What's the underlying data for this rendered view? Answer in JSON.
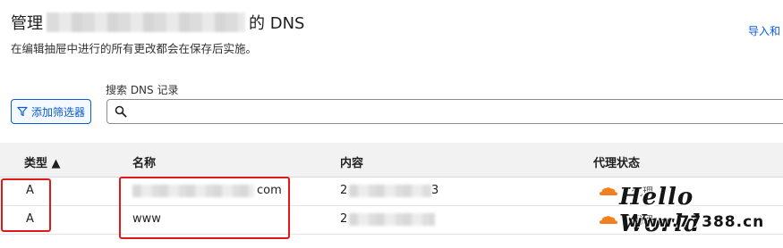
{
  "header": {
    "title_prefix": "管理",
    "title_suffix": "的 DNS",
    "subtitle": "在编辑抽屉中进行的所有更改都会在保存后实施。",
    "import_link": "导入和"
  },
  "search": {
    "label": "搜索 DNS 记录",
    "placeholder": ""
  },
  "filter": {
    "button_label": "添加筛选器"
  },
  "table": {
    "columns": [
      "类型 ▲",
      "名称",
      "内容",
      "代理状态"
    ],
    "rows": [
      {
        "type": "A",
        "name_suffix": "com",
        "content_prefix": "2",
        "content_suffix": "3",
        "proxy": "已代理"
      },
      {
        "type": "A",
        "name": "www",
        "content_prefix": "2",
        "proxy": "已代理"
      }
    ]
  },
  "watermark": {
    "line1": "Hello World",
    "line2": "www.77388.cn"
  },
  "colors": {
    "accent": "#0a5bd6",
    "highlight": "#e01818",
    "cloud": "#f38020"
  }
}
